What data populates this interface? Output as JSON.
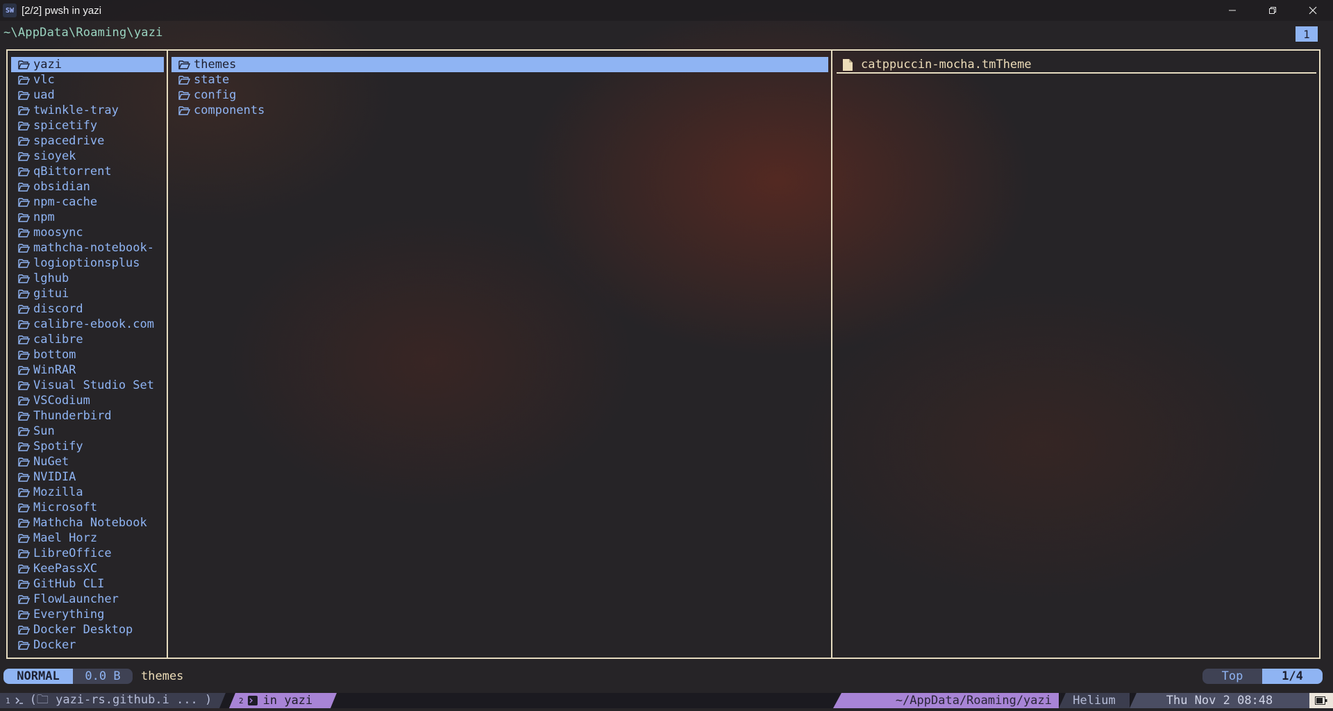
{
  "window": {
    "title": "[2/2] pwsh in yazi",
    "app_icon_text": "SW",
    "minimize_icon": "minimize-icon",
    "maximize_icon": "restore-icon",
    "close_icon": "close-icon"
  },
  "header": {
    "path": "~\\AppData\\Roaming\\yazi",
    "tab_number": "1"
  },
  "parent_pane": {
    "items": [
      {
        "name": "yazi",
        "selected": true
      },
      {
        "name": "vlc"
      },
      {
        "name": "uad"
      },
      {
        "name": "twinkle-tray"
      },
      {
        "name": "spicetify"
      },
      {
        "name": "spacedrive"
      },
      {
        "name": "sioyek"
      },
      {
        "name": "qBittorrent"
      },
      {
        "name": "obsidian"
      },
      {
        "name": "npm-cache"
      },
      {
        "name": "npm"
      },
      {
        "name": "moosync"
      },
      {
        "name": "mathcha-notebook-"
      },
      {
        "name": "logioptionsplus"
      },
      {
        "name": "lghub"
      },
      {
        "name": "gitui"
      },
      {
        "name": "discord"
      },
      {
        "name": "calibre-ebook.com"
      },
      {
        "name": "calibre"
      },
      {
        "name": "bottom"
      },
      {
        "name": "WinRAR"
      },
      {
        "name": "Visual Studio Set"
      },
      {
        "name": "VSCodium"
      },
      {
        "name": "Thunderbird"
      },
      {
        "name": "Sun"
      },
      {
        "name": "Spotify"
      },
      {
        "name": "NuGet"
      },
      {
        "name": "NVIDIA"
      },
      {
        "name": "Mozilla"
      },
      {
        "name": "Microsoft"
      },
      {
        "name": "Mathcha Notebook"
      },
      {
        "name": "Mael Horz"
      },
      {
        "name": "LibreOffice"
      },
      {
        "name": "KeePassXC"
      },
      {
        "name": "GitHub CLI"
      },
      {
        "name": "FlowLauncher"
      },
      {
        "name": "Everything"
      },
      {
        "name": "Docker Desktop"
      },
      {
        "name": "Docker"
      }
    ]
  },
  "current_pane": {
    "items": [
      {
        "name": "themes",
        "selected": true
      },
      {
        "name": "state"
      },
      {
        "name": "config"
      },
      {
        "name": "components"
      }
    ]
  },
  "preview_pane": {
    "file": "catppuccin-mocha.tmTheme"
  },
  "status": {
    "mode": "NORMAL",
    "size": "0.0 B",
    "name": "themes",
    "position_label": "Top",
    "position": "1/4"
  },
  "tmux": {
    "window1_index": "1",
    "window1_title": "(🗀 yazi-rs.github.i ... )",
    "window2_index": "2",
    "window2_title": "in yazi",
    "path": "~/AppData/Roaming/yazi",
    "host": "Helium",
    "datetime": "Thu Nov 2 08:48"
  },
  "colors": {
    "accent": "#8fb4f3",
    "border": "#e6dcc0",
    "path_text": "#9ad4c0",
    "tmux_purple": "#a884d6"
  }
}
